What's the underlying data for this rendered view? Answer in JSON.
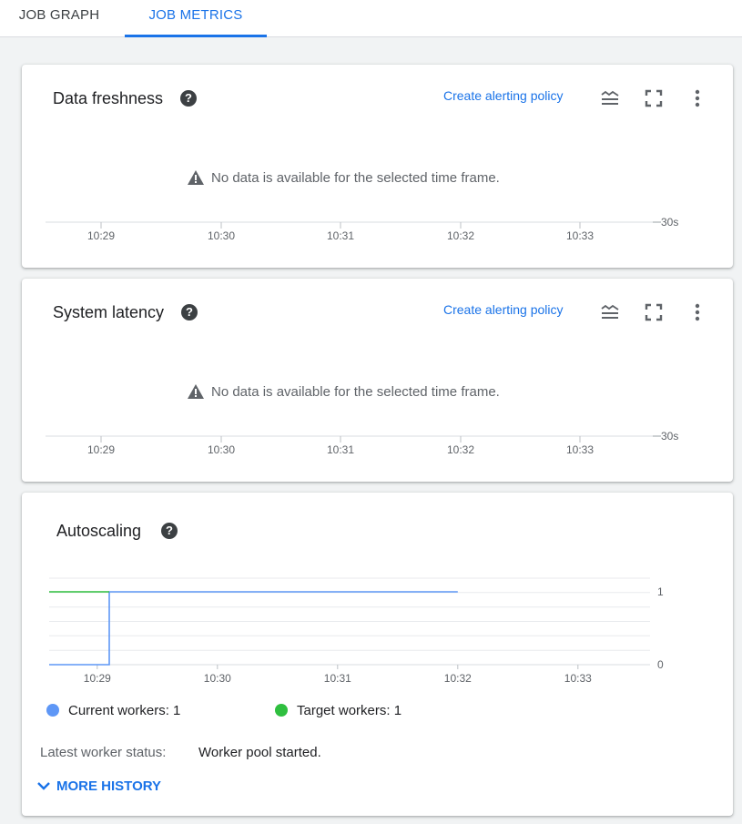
{
  "tabs": [
    {
      "label": "JOB GRAPH",
      "active": false
    },
    {
      "label": "JOB METRICS",
      "active": true
    }
  ],
  "accent_color": "#1a73e8",
  "cards": {
    "freshness": {
      "title": "Data freshness",
      "alert_link": "Create alerting policy",
      "no_data": "No data is available for the selected time frame.",
      "y_tick": "30s",
      "x_ticks": [
        "10:29",
        "10:30",
        "10:31",
        "10:32",
        "10:33"
      ],
      "icons": [
        "help-icon",
        "legend-toggle-icon",
        "fullscreen-icon",
        "more-vert-icon",
        "warning-icon"
      ]
    },
    "latency": {
      "title": "System latency",
      "alert_link": "Create alerting policy",
      "no_data": "No data is available for the selected time frame.",
      "y_tick": "30s",
      "x_ticks": [
        "10:29",
        "10:30",
        "10:31",
        "10:32",
        "10:33"
      ],
      "icons": [
        "help-icon",
        "legend-toggle-icon",
        "fullscreen-icon",
        "more-vert-icon",
        "warning-icon"
      ]
    },
    "autoscaling": {
      "title": "Autoscaling",
      "legend": [
        {
          "label": "Current workers:",
          "value": "1",
          "color": "#5e97f6"
        },
        {
          "label": "Target workers:",
          "value": "1",
          "color": "#2fbf3f"
        }
      ],
      "status_label": "Latest worker status:",
      "status_value": "Worker pool started.",
      "more_history": "MORE HISTORY"
    }
  },
  "chart_data": {
    "type": "line",
    "x_ticks": [
      "10:29",
      "10:30",
      "10:31",
      "10:32",
      "10:33"
    ],
    "y_ticks": [
      "0",
      "1"
    ],
    "ylim": [
      0,
      1
    ],
    "xlim": [
      "10:28.6",
      "10:33.6"
    ],
    "series": [
      {
        "name": "Current workers",
        "color": "#5e97f6",
        "points": [
          [
            "10:28.6",
            0
          ],
          [
            "10:29.1",
            0
          ],
          [
            "10:29.1",
            1
          ],
          [
            "10:32.0",
            1
          ]
        ]
      },
      {
        "name": "Target workers",
        "color": "#2fbf3f",
        "points": [
          [
            "10:28.6",
            1
          ],
          [
            "10:29.1",
            1
          ]
        ]
      }
    ],
    "grid": true
  }
}
